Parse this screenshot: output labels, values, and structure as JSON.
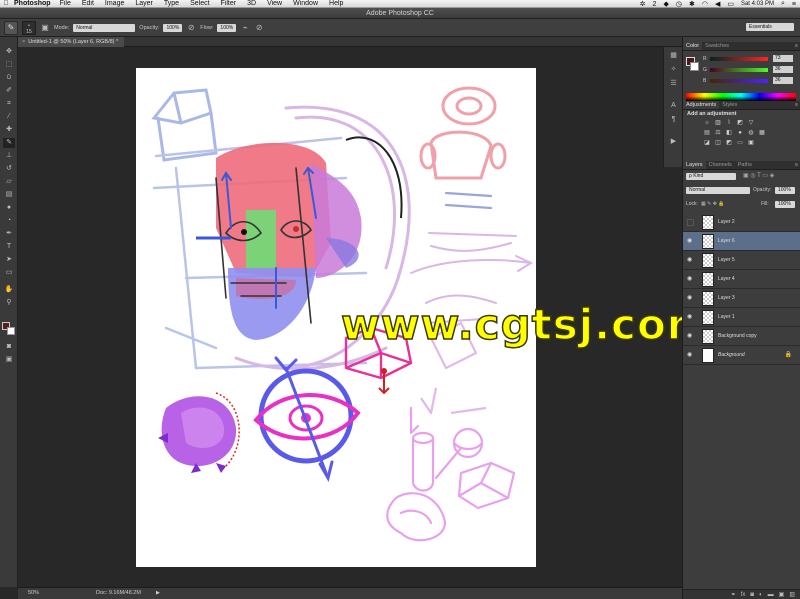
{
  "menubar": {
    "apple": "",
    "app": "Photoshop",
    "items": [
      "File",
      "Edit",
      "Image",
      "Layer",
      "Type",
      "Select",
      "Filter",
      "3D",
      "View",
      "Window",
      "Help"
    ],
    "status_num": "2",
    "clock": "Sat 4:03 PM"
  },
  "window": {
    "title": "Adobe Photoshop CC"
  },
  "options": {
    "brush_size": "15",
    "mode_label": "Mode:",
    "mode_value": "Normal",
    "opacity_label": "Opacity:",
    "opacity_value": "100%",
    "flow_label": "Flow:",
    "flow_value": "100%",
    "workspace": "Essentials"
  },
  "document": {
    "tab_close": "×",
    "tab_title": "Untitled-1 @ 50% (Layer 6, RGB/8) *"
  },
  "status": {
    "zoom": "50%",
    "doc_info": "Doc: 9.16M/48.2M",
    "arrow": "▶"
  },
  "watermark": "www.cgtsj.com",
  "color_panel": {
    "tabs": [
      "Color",
      "Swatches"
    ],
    "fg_color": "#491818",
    "rows": [
      {
        "label": "R",
        "value": "73"
      },
      {
        "label": "G",
        "value": "36"
      },
      {
        "label": "B",
        "value": "36"
      }
    ]
  },
  "adjustments_panel": {
    "tabs": [
      "Adjustments",
      "Styles"
    ],
    "title": "Add an adjustment"
  },
  "layers_panel": {
    "tabs": [
      "Layers",
      "Channels",
      "Paths"
    ],
    "kind_filter": "ρ Kind",
    "blend_mode": "Normal",
    "opacity_label": "Opacity:",
    "opacity_value": "100%",
    "lock_label": "Lock:",
    "fill_label": "Fill:",
    "fill_value": "100%",
    "layers": [
      {
        "name": "Layer 2",
        "visible": false,
        "selected": false
      },
      {
        "name": "Layer 6",
        "visible": true,
        "selected": true
      },
      {
        "name": "Layer 5",
        "visible": true,
        "selected": false
      },
      {
        "name": "Layer 4",
        "visible": true,
        "selected": false
      },
      {
        "name": "Layer 3",
        "visible": true,
        "selected": false
      },
      {
        "name": "Layer 1",
        "visible": true,
        "selected": false
      },
      {
        "name": "Background copy",
        "visible": true,
        "selected": false
      },
      {
        "name": "Background",
        "visible": true,
        "selected": false
      }
    ]
  }
}
